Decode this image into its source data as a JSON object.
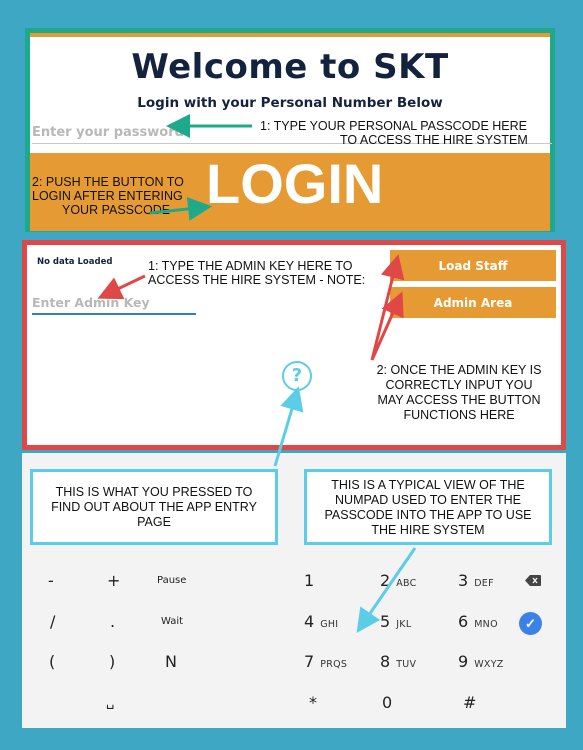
{
  "login": {
    "title": "Welcome to SKT",
    "subtitle": "Login with your Personal Number Below",
    "password_placeholder": "Enter your password",
    "login_button": "LOGIN",
    "note_password": [
      "1: TYPE YOUR PERSONAL PASSCODE HERE",
      "TO ACCESS THE HIRE SYSTEM"
    ],
    "note_button": [
      "2: PUSH THE BUTTON TO",
      "LOGIN AFTER ENTERING",
      "YOUR PASSCODE"
    ]
  },
  "admin": {
    "status": "No data Loaded",
    "admin_key_placeholder": "Enter Admin Key",
    "load_staff_button": "Load Staff",
    "admin_area_button": "Admin Area",
    "help_icon": "question-circle-icon",
    "note_admin_key": [
      "1: TYPE THE ADMIN KEY HERE TO",
      "ACCESS THE HIRE SYSTEM - NOTE:"
    ],
    "note_buttons": [
      "2: ONCE THE ADMIN KEY IS",
      "CORRECTLY INPUT YOU",
      "MAY ACCESS THE BUTTON",
      "FUNCTIONS HERE"
    ]
  },
  "callouts": {
    "pressed": [
      "THIS IS WHAT YOU PRESSED TO",
      "FIND OUT ABOUT THE APP ENTRY",
      "PAGE"
    ],
    "numpad": [
      "THIS IS A TYPICAL VIEW OF THE",
      "NUMPAD USED TO ENTER THE",
      "PASSCODE INTO THE APP TO USE",
      "THE HIRE SYSTEM"
    ]
  },
  "keypad": {
    "symbols": [
      [
        "-",
        "+",
        "Pause"
      ],
      [
        "/",
        ".",
        "Wait"
      ],
      [
        "(",
        ")",
        "N"
      ],
      [
        "",
        "␣",
        ""
      ]
    ],
    "digits": [
      [
        {
          "n": "1",
          "l": ""
        },
        {
          "n": "2",
          "l": "ABC"
        },
        {
          "n": "3",
          "l": "DEF"
        }
      ],
      [
        {
          "n": "4",
          "l": "GHI"
        },
        {
          "n": "5",
          "l": "JKL"
        },
        {
          "n": "6",
          "l": "MNO"
        }
      ],
      [
        {
          "n": "7",
          "l": "PRQS"
        },
        {
          "n": "8",
          "l": "TUV"
        },
        {
          "n": "9",
          "l": "WXYZ"
        }
      ],
      [
        {
          "n": "*",
          "l": ""
        },
        {
          "n": "0",
          "l": ""
        },
        {
          "n": "#",
          "l": ""
        }
      ]
    ],
    "backspace_icon": "backspace-icon",
    "confirm_icon": "check-icon"
  },
  "colors": {
    "background": "#3ea8c4",
    "login_frame": "#1eaa8a",
    "admin_frame": "#e04848",
    "button": "#e69a33",
    "arrow_green": "#1eaa8a",
    "arrow_red": "#e04848",
    "arrow_cyan": "#5ccde6"
  }
}
